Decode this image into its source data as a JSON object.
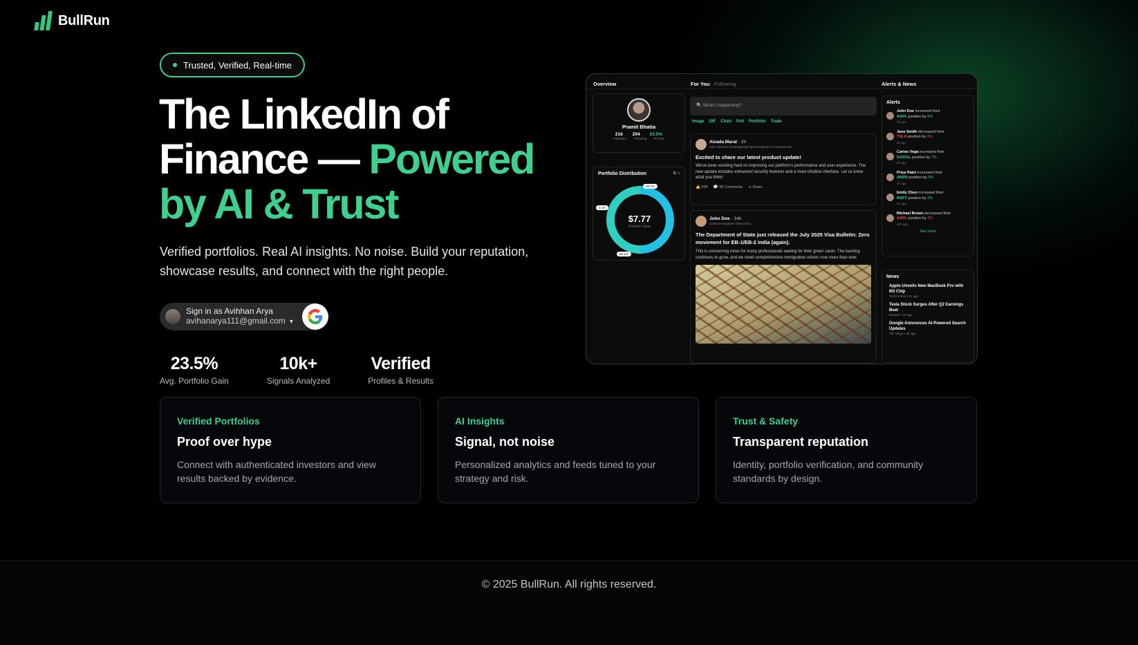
{
  "brand": {
    "name": "BullRun"
  },
  "hero": {
    "badge": "Trusted, Verified, Real-time",
    "title_line1": "The LinkedIn of",
    "title_line2_white": "Finance — ",
    "title_line2_green": "Powered",
    "title_line3_green": "by AI & Trust",
    "subtitle": "Verified portfolios. Real AI insights. No noise. Build your reputation, showcase results, and connect with the right people."
  },
  "signin": {
    "label": "Sign in as Avihhan Arya",
    "email": "avihanarya111@gmail.com"
  },
  "stats": [
    {
      "value": "23.5%",
      "label": "Avg. Portfolio Gain"
    },
    {
      "value": "10k+",
      "label": "Signals Analyzed"
    },
    {
      "value": "Verified",
      "label": "Profiles & Results"
    }
  ],
  "preview": {
    "overview_tab": "Overview",
    "feed_tabs": [
      "For You",
      "Following"
    ],
    "alerts_tab": "Alerts & News",
    "profile": {
      "name": "Pramit Bhatia",
      "followers": "216",
      "following": "204",
      "return": "23.5%",
      "l1": "Followers",
      "l2": "Following",
      "l3": "All Time"
    },
    "portfolio": {
      "title": "Portfolio Distribution",
      "value": "$7.77",
      "caption": "Portfolio Value",
      "p1": "49.7%",
      "p2": "0.1%",
      "p3": "50.2%"
    },
    "composer": {
      "placeholder": "What's happening?",
      "actions": [
        "Image",
        "GIF",
        "Chart",
        "Poll",
        "Portfolio",
        "Trade"
      ]
    },
    "post1": {
      "author": "Aizada Marat",
      "time": "· 2h",
      "role": "CEO @Arma | Reimagining legal immigration | Harvard Law",
      "headline": "Excited to share our latest product update!",
      "body": "We've been working hard on improving our platform's performance and user experience. The new update includes enhanced security features and a more intuitive interface. Let us know what you think!",
      "likes": "594",
      "comments": "48 Comments",
      "share": "Share"
    },
    "post2": {
      "author": "John Doe",
      "time": "· 14h",
      "role": "Software Engineer @Kyurrant",
      "headline": "The Department of State just released the July 2025 Visa Bulletin: Zero movement for EB-1/EB-2 India (again).",
      "body": "This is concerning news for many professionals waiting for their green cards. The backlog continues to grow, and we need comprehensive immigration reform now more than ever."
    },
    "alerts_title": "Alerts",
    "alerts": [
      {
        "name": "John Doe",
        "verb": "increased their",
        "ticker": "AAPL",
        "suffix": "position by",
        "pct": "5%",
        "time": "2h ago",
        "up": true
      },
      {
        "name": "Jane Smith",
        "verb": "decreased their",
        "ticker": "TSLA",
        "suffix": "position by",
        "pct": "3%",
        "time": "4h ago",
        "up": false
      },
      {
        "name": "Carlos Vega",
        "verb": "increased their",
        "ticker": "GOOGL",
        "suffix": "position by",
        "pct": "7%",
        "time": "5h ago",
        "up": true
      },
      {
        "name": "Priya Patel",
        "verb": "increased their",
        "ticker": "AMZN",
        "suffix": "position by",
        "pct": "4%",
        "time": "7h ago",
        "up": true
      },
      {
        "name": "Emily Chen",
        "verb": "increased their",
        "ticker": "MSFT",
        "suffix": "position by",
        "pct": "2%",
        "time": "9h ago",
        "up": true
      },
      {
        "name": "Michael Brown",
        "verb": "decreased their",
        "ticker": "AAPL",
        "suffix": "position by",
        "pct": "2%",
        "time": "10h ago",
        "up": false
      }
    ],
    "see_more": "See more",
    "news_title": "News",
    "news": [
      {
        "title": "Apple Unveils New MacBook Pro with M3 Chip",
        "meta": "TechCrunch • 1h ago"
      },
      {
        "title": "Tesla Stock Surges After Q2 Earnings Beat",
        "meta": "Reuters • 2h ago"
      },
      {
        "title": "Google Announces AI-Powered Search Updates",
        "meta": "The Verge • 3h ago"
      }
    ]
  },
  "features": [
    {
      "kicker": "Verified Portfolios",
      "title": "Proof over hype",
      "desc": "Connect with authenticated investors and view results backed by evidence."
    },
    {
      "kicker": "AI Insights",
      "title": "Signal, not noise",
      "desc": "Personalized analytics and feeds tuned to your strategy and risk."
    },
    {
      "kicker": "Trust & Safety",
      "title": "Transparent reputation",
      "desc": "Identity, portfolio verification, and community standards by design."
    }
  ],
  "footer": {
    "text": "© 2025 BullRun. All rights reserved."
  },
  "colors": {
    "accent": "#3fcf8e",
    "background": "#000000"
  }
}
